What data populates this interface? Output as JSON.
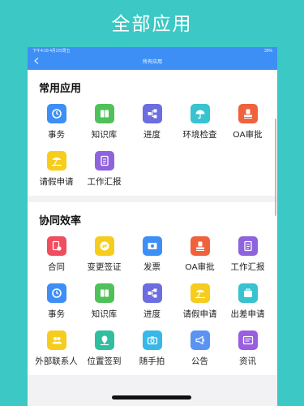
{
  "hero": {
    "title": "全部应用"
  },
  "status_bar": {
    "time": "下午4:18",
    "date": "4月2日周五",
    "battery": "39%"
  },
  "nav": {
    "title": "所有应用"
  },
  "sections": [
    {
      "title": "常用应用",
      "apps": [
        {
          "label": "事务",
          "icon": "clock-icon",
          "color": "#3e8ff5"
        },
        {
          "label": "知识库",
          "icon": "book-icon",
          "color": "#4fc15a"
        },
        {
          "label": "进度",
          "icon": "flowchart-icon",
          "color": "#6b6de0"
        },
        {
          "label": "环境检查",
          "icon": "umbrella-icon",
          "color": "#37c3cf"
        },
        {
          "label": "OA审批",
          "icon": "stamp-icon",
          "color": "#f0623c"
        },
        {
          "label": "请假申请",
          "icon": "beach-icon",
          "color": "#f6cd1e"
        },
        {
          "label": "工作汇报",
          "icon": "report-icon",
          "color": "#8e63dd"
        }
      ]
    },
    {
      "title": "协同效率",
      "apps": [
        {
          "label": "合同",
          "icon": "contract-icon",
          "color": "#f04e5e"
        },
        {
          "label": "变更签证",
          "icon": "exchange-icon",
          "color": "#f6cd1e"
        },
        {
          "label": "发票",
          "icon": "invoice-icon",
          "color": "#3e8ff5"
        },
        {
          "label": "OA审批",
          "icon": "stamp-icon",
          "color": "#f0623c"
        },
        {
          "label": "工作汇报",
          "icon": "report-icon",
          "color": "#8e63dd"
        },
        {
          "label": "事务",
          "icon": "clock-icon",
          "color": "#3e8ff5"
        },
        {
          "label": "知识库",
          "icon": "book-icon",
          "color": "#4fc15a"
        },
        {
          "label": "进度",
          "icon": "flowchart-icon",
          "color": "#6b6de0"
        },
        {
          "label": "请假申请",
          "icon": "beach-icon",
          "color": "#f6cd1e"
        },
        {
          "label": "出差申请",
          "icon": "travel-icon",
          "color": "#37c3cf"
        },
        {
          "label": "外部联系人",
          "icon": "contacts-icon",
          "color": "#f6cd1e"
        },
        {
          "label": "位置签到",
          "icon": "location-icon",
          "color": "#2fbfa0"
        },
        {
          "label": "随手拍",
          "icon": "camera-icon",
          "color": "#37b8e8"
        },
        {
          "label": "公告",
          "icon": "megaphone-icon",
          "color": "#5a93f2"
        },
        {
          "label": "资讯",
          "icon": "news-icon",
          "color": "#9a5ee0"
        }
      ]
    }
  ]
}
